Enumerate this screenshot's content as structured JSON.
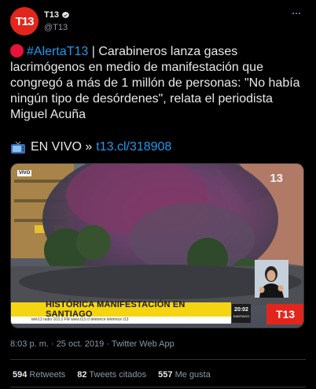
{
  "account": {
    "avatar_text": "T13",
    "display_name": "T13",
    "handle": "@T13"
  },
  "tweet": {
    "hashtag": "#AlertaT13",
    "body": " | Carabineros lanza gases lacrimógenos en medio de manifestación que congregó a más de 1 millón de personas: \"No había ningún tipo de desórdenes\", relata el periodista Miguel Acuña",
    "live_label": "EN VIVO »",
    "link": "t13.cl/318908"
  },
  "media": {
    "vivo_tag": "VIVO",
    "corner_logo": "13",
    "headline": "HISTÓRICA MANIFESTACIÓN EN SANTIAGO",
    "ticker": "tele13 radio 103.3 FM   www.t13.cl   teletrece   teletrece   t13",
    "clock_time": "20:02",
    "clock_city": "SANTIAGO",
    "clock_temp": "24° 28°",
    "badge": "T13"
  },
  "meta": {
    "timestamp": "8:03 p. m. · 25 oct. 2019",
    "separator": " · ",
    "app": "Twitter Web App"
  },
  "stats": {
    "retweets_count": "594",
    "retweets_label": "Retweets",
    "quotes_count": "82",
    "quotes_label": "Tweets citados",
    "likes_count": "557",
    "likes_label": "Me gusta"
  },
  "colors": {
    "accent": "#1d9bf0",
    "brand_red": "#e2261d",
    "background": "#000000",
    "muted": "#8b98a5"
  },
  "icons": [
    "verified-badge-icon",
    "more-options-icon",
    "red-circle-emoji-icon",
    "television-emoji-icon"
  ]
}
